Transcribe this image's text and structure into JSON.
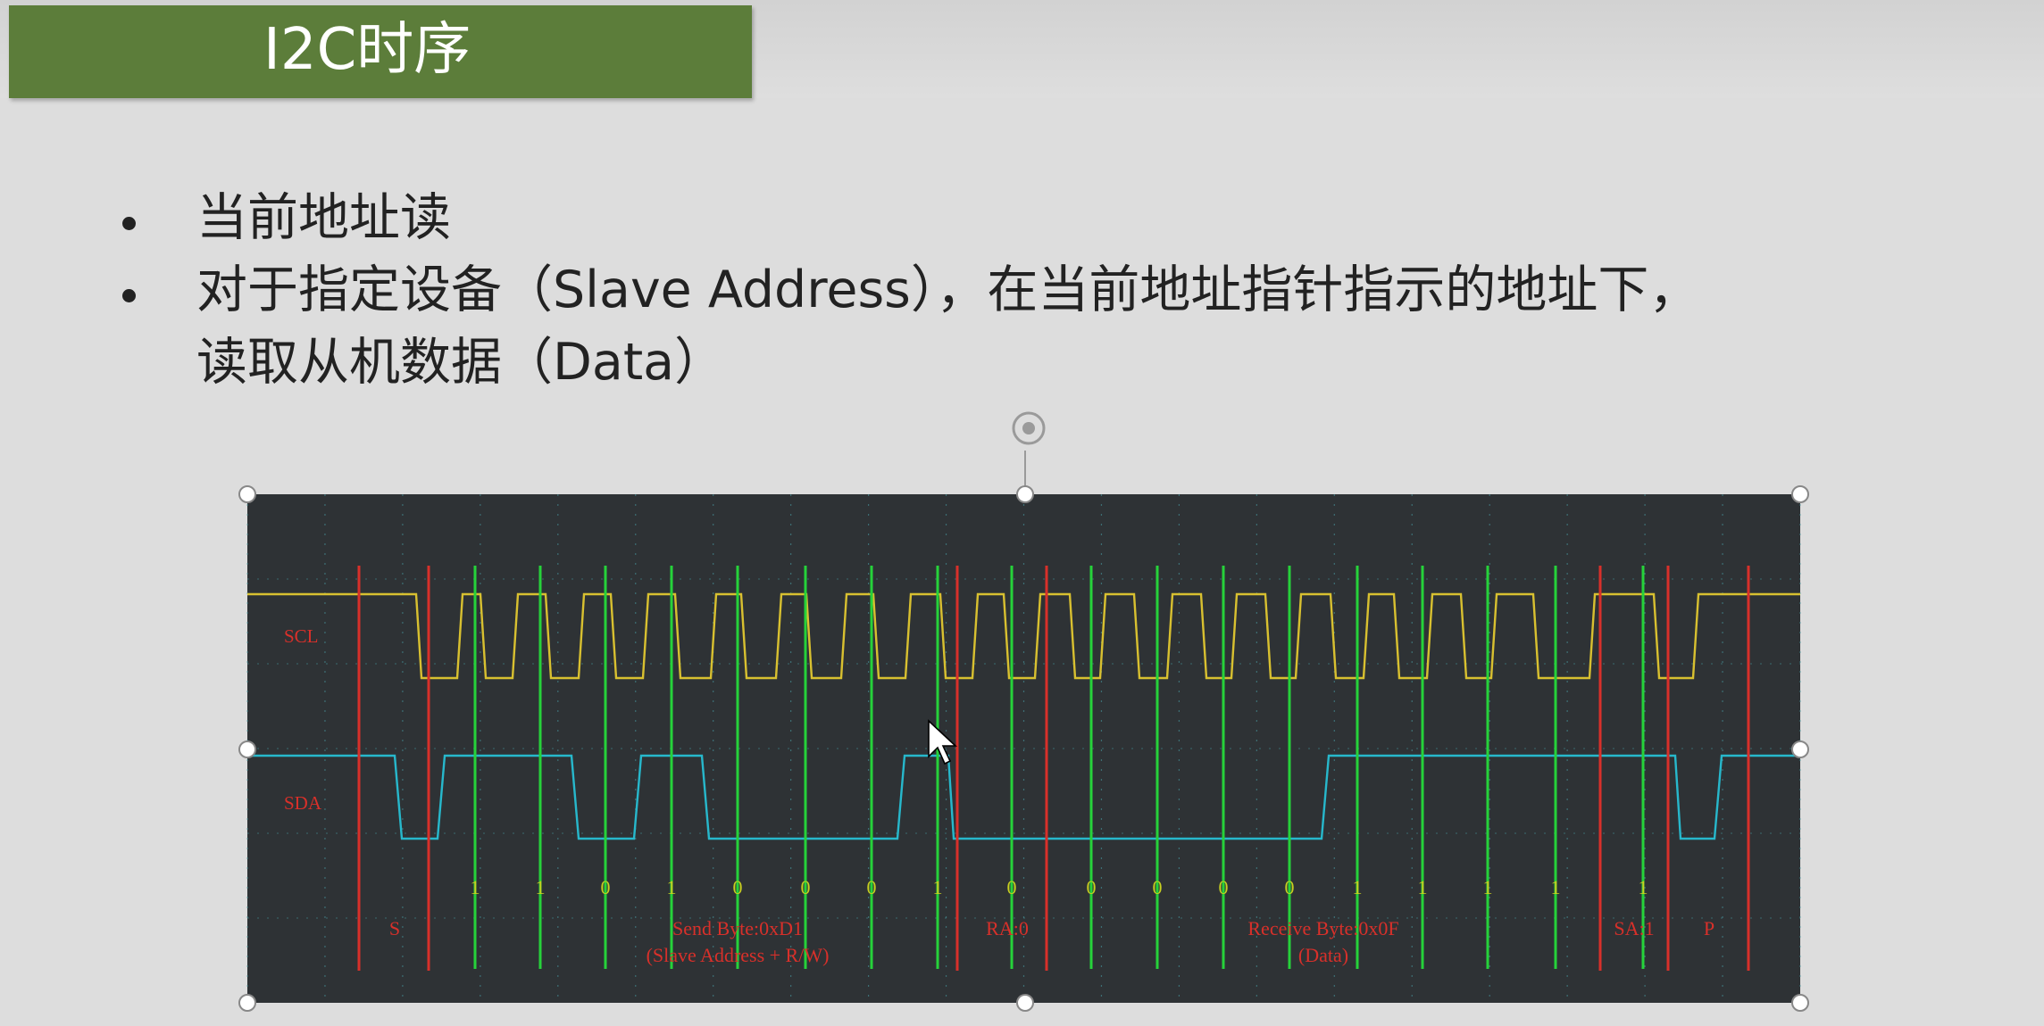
{
  "slide": {
    "title": "I2C时序",
    "bullets": [
      {
        "lines": [
          "当前地址读"
        ]
      },
      {
        "lines": [
          "对于指定设备（Slave Address），在当前地址指针指示的地址下，",
          "读取从机数据（Data）"
        ]
      }
    ]
  },
  "diagram": {
    "signals": [
      {
        "name": "SCL",
        "color": "#d8c030"
      },
      {
        "name": "SDA",
        "color": "#27b8cc"
      }
    ],
    "bits": [
      "1",
      "1",
      "0",
      "1",
      "0",
      "0",
      "0",
      "1",
      "0",
      "0",
      "0",
      "0",
      "0",
      "1",
      "1",
      "1",
      "1",
      "1"
    ],
    "segments": [
      {
        "lines": [
          "S"
        ]
      },
      {
        "lines": [
          "Send Byte:0xD1",
          "(Slave Address + R/W)"
        ]
      },
      {
        "lines": [
          "RA:0"
        ]
      },
      {
        "lines": [
          "Receive Byte:0x0F",
          "(Data)"
        ]
      },
      {
        "lines": [
          "SA:1"
        ]
      },
      {
        "lines": [
          "P"
        ]
      }
    ],
    "colors": {
      "background": "#2e3235",
      "boundary_line": "#d8302a",
      "sample_line": "#26d23a",
      "label": "#d8302a",
      "bit_label": "#c8d020",
      "grid": "#4aa0a8"
    }
  }
}
